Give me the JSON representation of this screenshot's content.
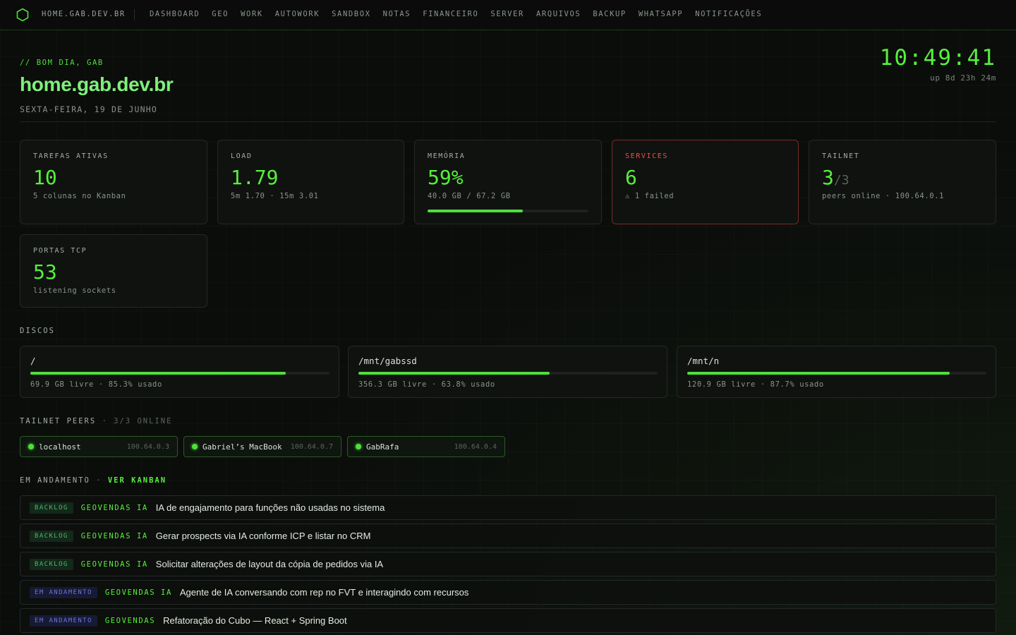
{
  "nav": {
    "logo_icon": "hexagon-icon",
    "brand": "HOME.GAB.DEV.BR",
    "items": [
      "DASHBOARD",
      "GEO",
      "WORK",
      "AUTOWORK",
      "SANDBOX",
      "NOTAS",
      "FINANCEIRO",
      "SERVER",
      "ARQUIVOS",
      "BACKUP",
      "WHATSAPP",
      "NOTIFICAÇÕES"
    ]
  },
  "header": {
    "greeting": "// BOM DIA, GAB",
    "title": "home.gab.dev.br",
    "date": "SEXTA-FEIRA, 19 DE JUNHO",
    "clock": "10:49:41",
    "uptime": "up 8d 23h 24m"
  },
  "stats": {
    "tasks": {
      "label": "TAREFAS ATIVAS",
      "value": "10",
      "sub": "5 colunas no Kanban"
    },
    "load": {
      "label": "LOAD",
      "value": "1.79",
      "sub": "5m 1.70 · 15m 3.01"
    },
    "memory": {
      "label": "MEMÓRIA",
      "value": "59%",
      "sub": "40.0 GB / 67.2 GB",
      "percent": 59
    },
    "services": {
      "label": "SERVICES",
      "value": "6",
      "sub": "⚠ 1 failed"
    },
    "tailnet": {
      "label": "TAILNET",
      "value": "3",
      "denom": "/3",
      "sub": "peers online · 100.64.0.1"
    },
    "ports": {
      "label": "PORTAS TCP",
      "value": "53",
      "sub": "listening sockets"
    }
  },
  "disks": {
    "section_label": "DISCOS",
    "items": [
      {
        "mount": "/",
        "info": "69.9 GB livre · 85.3% usado",
        "percent": 85.3
      },
      {
        "mount": "/mnt/gabssd",
        "info": "356.3 GB livre · 63.8% usado",
        "percent": 63.8
      },
      {
        "mount": "/mnt/n",
        "info": "120.9 GB livre · 87.7% usado",
        "percent": 87.7
      }
    ]
  },
  "peers": {
    "section_label": "TAILNET PEERS",
    "section_sep": "·",
    "section_count": "3/3 ONLINE",
    "items": [
      {
        "name": "localhost",
        "ip": "100.64.0.3"
      },
      {
        "name": "Gabriel’s MacBook",
        "ip": "100.64.0.7"
      },
      {
        "name": "GabRafa",
        "ip": "100.64.0.4"
      }
    ]
  },
  "tasks": {
    "section_label": "EM ANDAMENTO",
    "section_sep": "·",
    "link": "VER KANBAN",
    "items": [
      {
        "status": "BACKLOG",
        "project": "GEOVENDAS IA",
        "title": "IA de engajamento para funções não usadas no sistema"
      },
      {
        "status": "BACKLOG",
        "project": "GEOVENDAS IA",
        "title": "Gerar prospects via IA conforme ICP e listar no CRM"
      },
      {
        "status": "BACKLOG",
        "project": "GEOVENDAS IA",
        "title": "Solicitar alterações de layout da cópia de pedidos via IA"
      },
      {
        "status": "EM ANDAMENTO",
        "project": "GEOVENDAS IA",
        "title": "Agente de IA conversando com rep no FVT e interagindo com recursos"
      },
      {
        "status": "EM ANDAMENTO",
        "project": "GEOVENDAS",
        "title": "Refatoração do Cubo — React + Spring Boot"
      }
    ]
  },
  "colors": {
    "accent": "#56f03c",
    "alert": "#f0504a",
    "backlog": "#4bb86a",
    "in_progress": "#6b74e0"
  }
}
